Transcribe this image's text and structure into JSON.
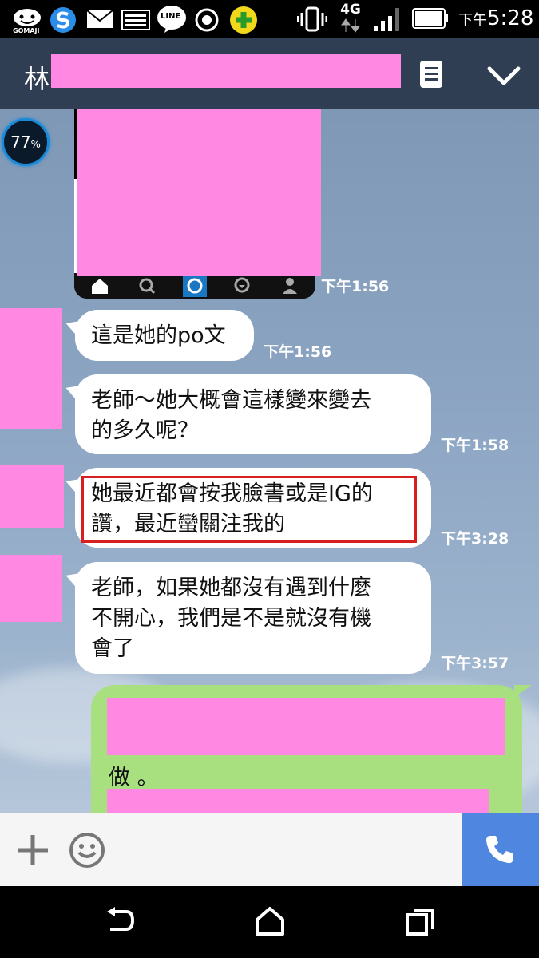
{
  "status_bar": {
    "clock_prefix": "下午",
    "clock": "5:28",
    "network": "4G",
    "gomaji_label": "GOMAJI",
    "line_label": "LINE",
    "icons": [
      "gomaji-icon",
      "s-app-icon",
      "mail-icon",
      "image-icon",
      "line-icon",
      "circle-icon",
      "plus-badge-icon",
      "vibrate-icon",
      "signal-icon",
      "battery-icon"
    ]
  },
  "header": {
    "title_prefix": "林",
    "menu_icon": "notes-icon",
    "collapse_icon": "chevron-down-icon"
  },
  "overlay": {
    "battery_percent": "77",
    "percent_sign": "%"
  },
  "messages": [
    {
      "type": "image",
      "time": "下午1:56"
    },
    {
      "type": "text",
      "text": "這是她的po文",
      "time": "下午1:56"
    },
    {
      "type": "text",
      "line1": "老師～她大概會這樣變來變去",
      "line2": "的多久呢？",
      "time": "下午1:58"
    },
    {
      "type": "text",
      "line1": "她最近都會按我臉書或是IG的",
      "line2": "讚，最近蠻關注我的",
      "time": "下午3:28",
      "highlighted": true
    },
    {
      "type": "text",
      "line1": "老師，如果她都沒有遇到什麼",
      "line2": "不開心，我們是不是就沒有機",
      "line3": "會了",
      "time": "下午3:57"
    },
    {
      "type": "outgoing",
      "visible_text": "做 。"
    }
  ],
  "colors": {
    "header_bg": "#2f3e52",
    "outgoing_bubble": "#a8e080",
    "highlight_border": "#d62020",
    "call_button": "#4f86e0",
    "redaction": "#ff88e2"
  },
  "input_bar": {
    "add_icon": "plus-icon",
    "emoji_icon": "smiley-icon",
    "call_icon": "phone-icon"
  },
  "nav_bar": {
    "icons": [
      "back-icon",
      "home-icon",
      "recents-icon"
    ]
  }
}
